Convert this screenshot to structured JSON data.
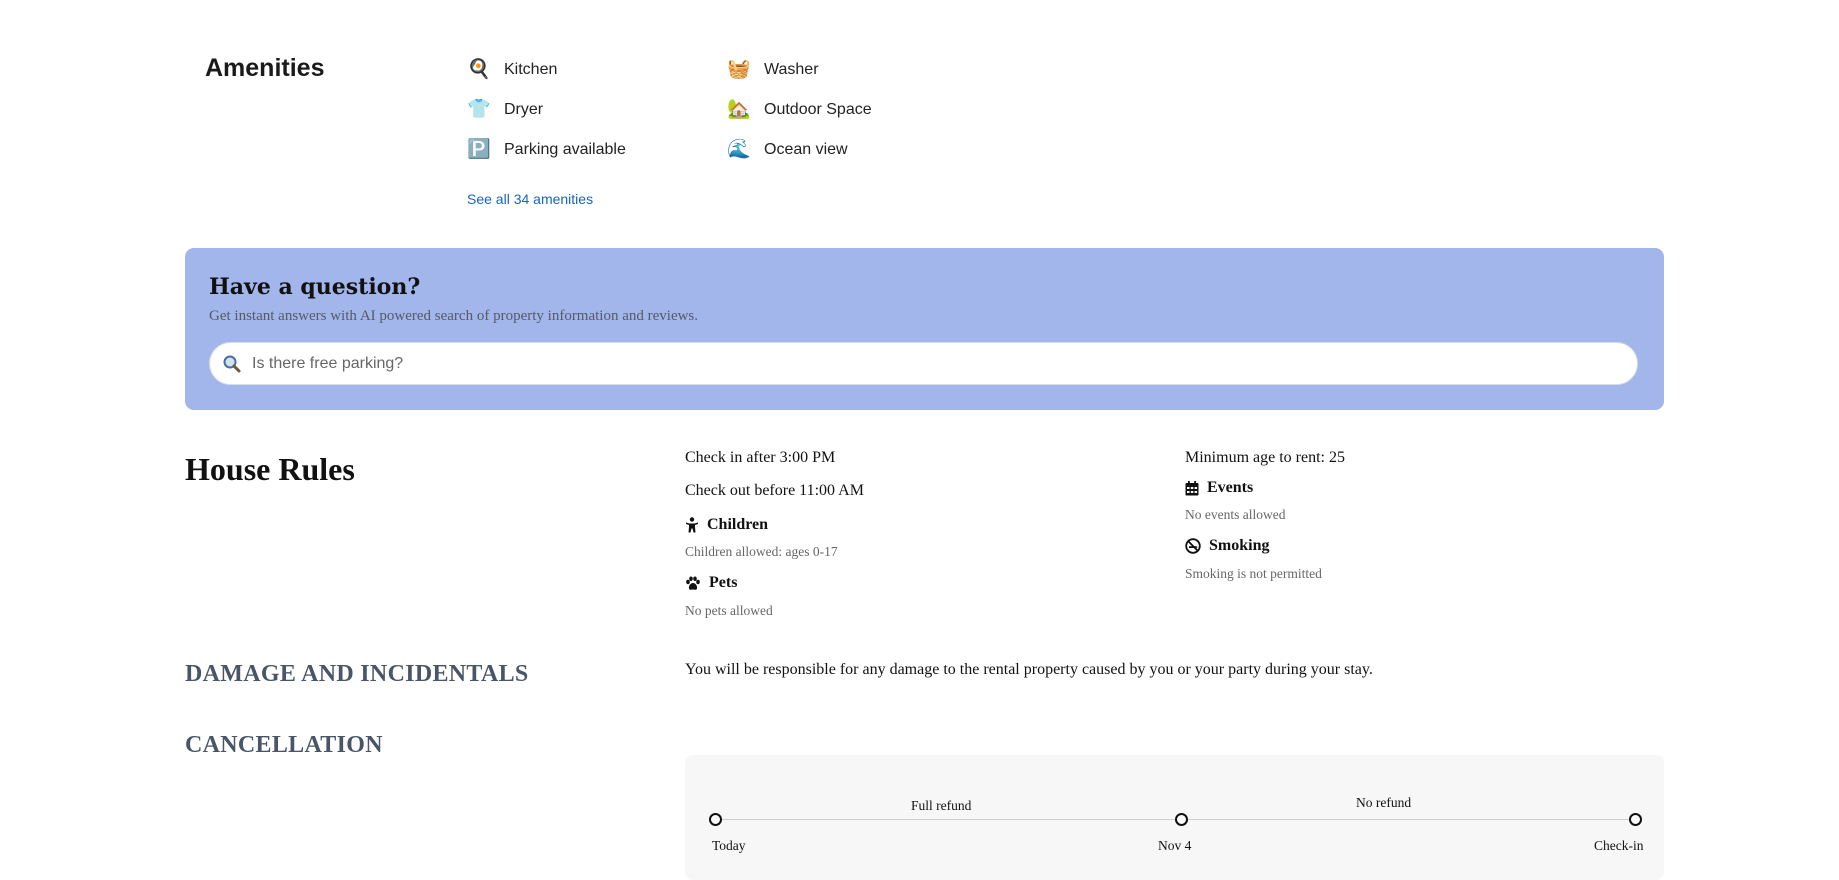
{
  "amenities": {
    "title": "Amenities",
    "items": [
      {
        "label": "Kitchen",
        "icon": "🍳"
      },
      {
        "label": "Washer",
        "icon": "🧺"
      },
      {
        "label": "Dryer",
        "icon": "👕"
      },
      {
        "label": "Outdoor Space",
        "icon": "🏡"
      },
      {
        "label": "Parking available",
        "icon": "🅿️"
      },
      {
        "label": "Ocean view",
        "icon": "🌊"
      }
    ],
    "see_all": "See all 34 amenities"
  },
  "question": {
    "title": "Have a question?",
    "subtitle": "Get instant answers with AI powered search of property information and reviews.",
    "placeholder": "Is there free parking?"
  },
  "house_rules": {
    "title": "House Rules",
    "check_in": "Check in after 3:00 PM",
    "check_out": "Check out before 11:00 AM",
    "children": {
      "label": "Children",
      "detail": "Children allowed: ages 0-17"
    },
    "pets": {
      "label": "Pets",
      "detail": "No pets allowed"
    },
    "min_age": "Minimum age to rent: 25",
    "events": {
      "label": "Events",
      "detail": "No events allowed"
    },
    "smoking": {
      "label": "Smoking",
      "detail": "Smoking is not permitted"
    }
  },
  "damage": {
    "title": "DAMAGE AND INCIDENTALS",
    "text": "You will be responsible for any damage to the rental property caused by you or your party during your stay."
  },
  "cancellation": {
    "title": "CANCELLATION",
    "segments": [
      "Full refund",
      "No refund"
    ],
    "points": [
      "Today",
      "Nov 4",
      "Check-in"
    ]
  },
  "colors": {
    "panel": "#a2b6eb",
    "link": "#1565c0",
    "section_heading": "#4a5668"
  }
}
